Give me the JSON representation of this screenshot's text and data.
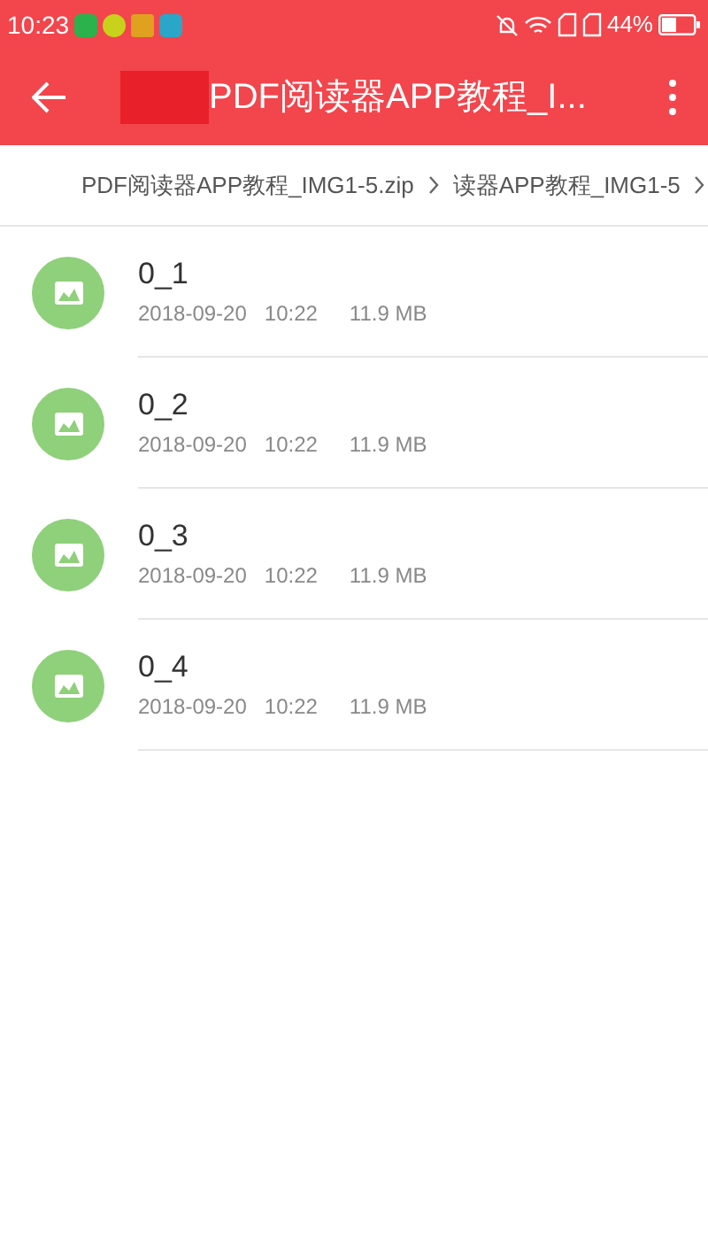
{
  "status_bar": {
    "time": "10:23",
    "battery": "44%"
  },
  "toolbar": {
    "title": "PDF阅读器APP教程_I..."
  },
  "breadcrumb": [
    {
      "label": "PDF阅读器APP教程_IMG1-5.zip"
    },
    {
      "label": "读器APP教程_IMG1-5"
    }
  ],
  "files": [
    {
      "name": "0_1",
      "date": "2018-09-20",
      "time": "10:22",
      "size": "11.9 MB"
    },
    {
      "name": "0_2",
      "date": "2018-09-20",
      "time": "10:22",
      "size": "11.9 MB"
    },
    {
      "name": "0_3",
      "date": "2018-09-20",
      "time": "10:22",
      "size": "11.9 MB"
    },
    {
      "name": "0_4",
      "date": "2018-09-20",
      "time": "10:22",
      "size": "11.9 MB"
    }
  ]
}
